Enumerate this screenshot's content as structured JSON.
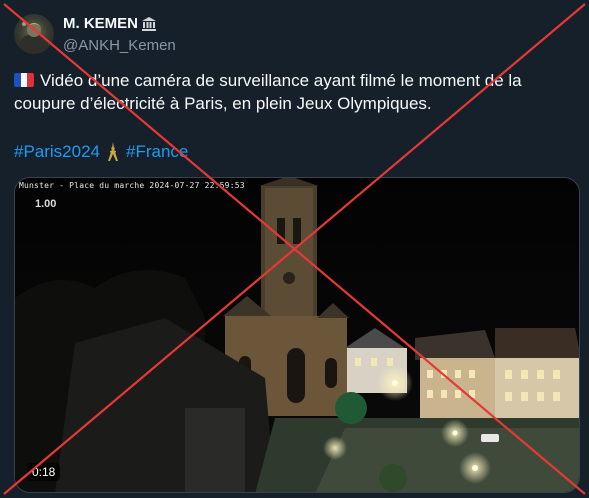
{
  "author": {
    "display_name": "M. KEMEN",
    "handle": "@ANKH_Kemen",
    "badge_icon": "bank-icon",
    "avatar_icon": "avatar-photo"
  },
  "tweet": {
    "flag_icon": "france-flag-icon",
    "text": "Vidéo d’une caméra de surveillance ayant filmé le moment de la coupure d’électricité à Paris, en plein Jeux Olympiques.",
    "hashtags": [
      "#Paris2024",
      "#France"
    ],
    "hashtag_separator_icon": "eiffel-tower-icon"
  },
  "media": {
    "camera_stamp": "Munster - Place du marche 2024-07-27 22:59:53",
    "zoom_label": "1.00",
    "duration": "0:18"
  },
  "overlay": {
    "cross_color": "#e53935"
  },
  "colors": {
    "background": "#15202b",
    "link": "#1d9bf0",
    "muted": "#8b98a5"
  }
}
